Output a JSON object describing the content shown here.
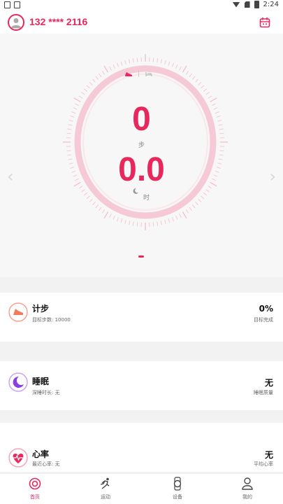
{
  "status_bar": {
    "time": "2:24"
  },
  "header": {
    "phone": "132 **** 2116"
  },
  "hero": {
    "steps_value": "0",
    "steps_label": "步",
    "hours_value": "0.0",
    "hours_label": "时",
    "page_count": 1,
    "accent_color": "#e8275c"
  },
  "cards": [
    {
      "title": "计步",
      "subtitle": "目标步数: 10000",
      "value": "0%",
      "value_label": "目标完成"
    },
    {
      "title": "睡眠",
      "subtitle": "深睡时长: 无",
      "value": "无",
      "value_label": "睡眠质量"
    },
    {
      "title": "心率",
      "subtitle": "最近心率: 无",
      "value": "无",
      "value_label": "平均心率"
    }
  ],
  "bottom_nav": [
    {
      "label": "首页",
      "icon": "home-icon",
      "active": true
    },
    {
      "label": "运动",
      "icon": "running-icon",
      "active": false
    },
    {
      "label": "设备",
      "icon": "watch-icon",
      "active": false
    },
    {
      "label": "我的",
      "icon": "profile-icon",
      "active": false
    }
  ]
}
